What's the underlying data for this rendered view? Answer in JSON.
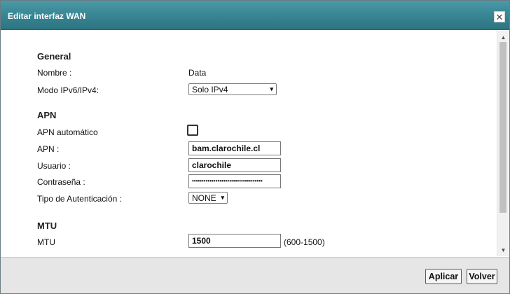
{
  "window": {
    "title": "Editar interfaz WAN",
    "close_glyph": "✕"
  },
  "general": {
    "heading": "General",
    "nombre_label": "Nombre :",
    "nombre_value": "Data",
    "modo_label": "Modo IPv6/IPv4:",
    "modo_value": "Solo IPv4"
  },
  "apn": {
    "heading": "APN",
    "auto_label": "APN automático",
    "auto_checked": false,
    "apn_label": "APN :",
    "apn_value": "bam.clarochile.cl",
    "user_label": "Usuario :",
    "user_value": "clarochile",
    "pwd_label": "Contraseña :",
    "pwd_value": "••••••••••••••••••••••••••••••••••••",
    "auth_label": "Tipo de Autenticación :",
    "auth_value": "NONE"
  },
  "mtu": {
    "heading": "MTU",
    "label": "MTU",
    "value": "1500",
    "hint": "(600-1500)"
  },
  "footer": {
    "apply_label": "Aplicar",
    "back_label": "Volver"
  },
  "icons": {
    "chevron": "▾",
    "scroll_up": "▲",
    "scroll_down": "▼"
  }
}
